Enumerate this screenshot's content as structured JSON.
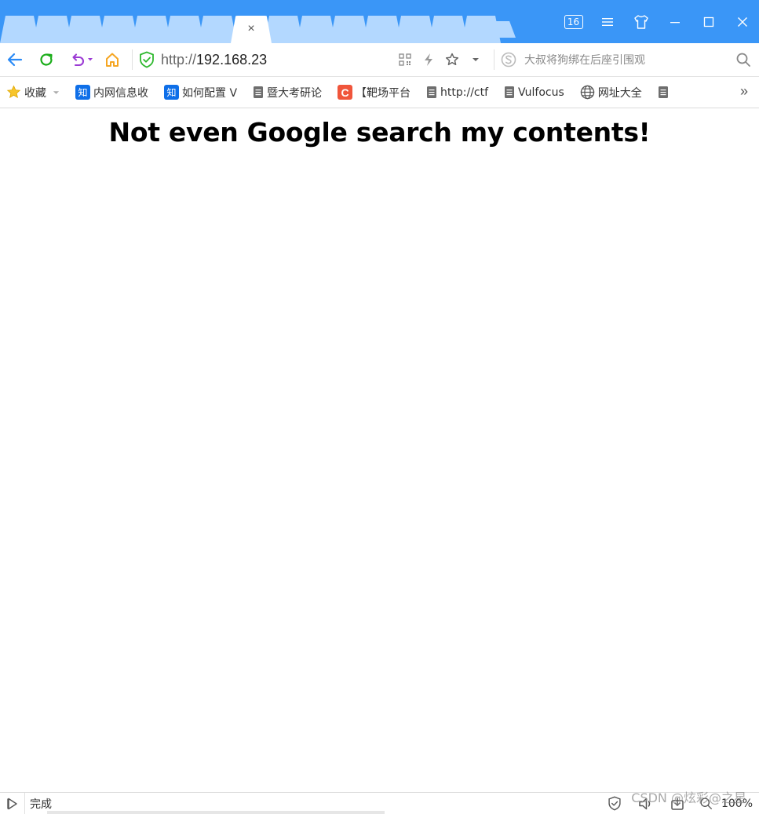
{
  "window": {
    "tab_count": "16",
    "active_tab_close": "×"
  },
  "toolbar": {
    "url_protocol": "http://",
    "url_host": "192.168.23",
    "search_placeholder": "大叔将狗绑在后座引围观"
  },
  "bookmarks": {
    "favorites_label": "收藏",
    "items": [
      {
        "label": "内网信息收",
        "icon": "zhihu-icon"
      },
      {
        "label": "如何配置 V",
        "icon": "zhihu-icon"
      },
      {
        "label": "暨大考研论",
        "icon": "page-icon"
      },
      {
        "label": "【靶场平台",
        "icon": "c-logo-icon"
      },
      {
        "label": "http://ctf",
        "icon": "page-icon"
      },
      {
        "label": "Vulfocus",
        "icon": "page-icon"
      },
      {
        "label": "网址大全",
        "icon": "globe-icon"
      },
      {
        "label": "",
        "icon": "page-icon"
      }
    ],
    "more": "»"
  },
  "page": {
    "heading": "Not even Google search my contents!"
  },
  "status": {
    "text": "完成",
    "zoom": "100%",
    "watermark": "CSDN @炫彩@之星"
  },
  "colors": {
    "tabbar_bg": "#3a96f7",
    "tab_inactive": "#b3d8ff",
    "back_arrow": "#2a8af6",
    "refresh": "#1aad19",
    "undo": "#9b3bd4",
    "home": "#f5a623",
    "shield": "#2eb82e"
  }
}
